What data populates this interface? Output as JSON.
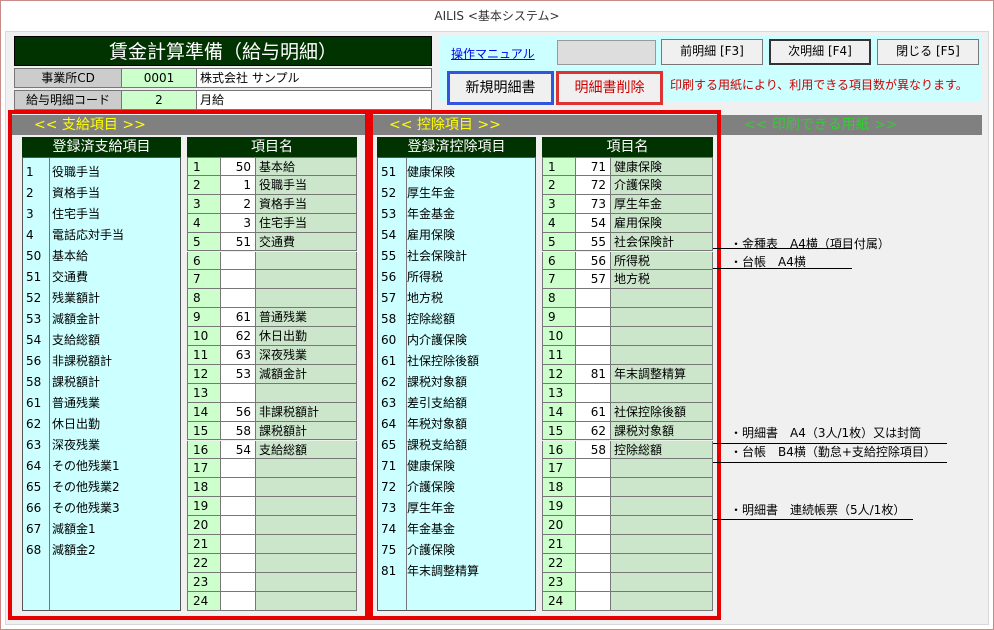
{
  "window": {
    "title": "AILIS <基本システム>"
  },
  "header": {
    "title": "賃金計算準備（給与明細）",
    "office_label": "事業所CD",
    "office_code": "0001",
    "company_name": "株式会社 サンプル",
    "payslip_label": "給与明細コード",
    "payslip_code": "2",
    "payslip_name": "月給"
  },
  "toolbar": {
    "manual_link": "操作マニュアル",
    "prev_button": "前明細 [F3]",
    "next_button": "次明細 [F4]",
    "close_button": "閉じる [F5]",
    "new_button": "新規明細書",
    "delete_button": "明細書削除",
    "notice": "印刷する用紙により、利用できる項目数が異なります。"
  },
  "sections": {
    "payment": "<< 支給項目 >>",
    "deduction": "<< 控除項目 >>",
    "paper": "<< 印刷できる用紙 >>"
  },
  "payment": {
    "registered_header": "登録済支給項目",
    "grid_header": "項目名",
    "registered": [
      {
        "code": "1",
        "name": "役職手当"
      },
      {
        "code": "2",
        "name": "資格手当"
      },
      {
        "code": "3",
        "name": "住宅手当"
      },
      {
        "code": "4",
        "name": "電話応対手当"
      },
      {
        "code": "50",
        "name": "基本給"
      },
      {
        "code": "51",
        "name": "交通費"
      },
      {
        "code": "52",
        "name": "残業額計"
      },
      {
        "code": "53",
        "name": "減額金計"
      },
      {
        "code": "54",
        "name": "支給総額"
      },
      {
        "code": "56",
        "name": "非課税額計"
      },
      {
        "code": "58",
        "name": "課税額計"
      },
      {
        "code": "61",
        "name": "普通残業"
      },
      {
        "code": "62",
        "name": "休日出勤"
      },
      {
        "code": "63",
        "name": "深夜残業"
      },
      {
        "code": "64",
        "name": "その他残業1"
      },
      {
        "code": "65",
        "name": "その他残業2"
      },
      {
        "code": "66",
        "name": "その他残業3"
      },
      {
        "code": "67",
        "name": "減額金1"
      },
      {
        "code": "68",
        "name": "減額金2"
      }
    ],
    "grid": [
      {
        "no": "1",
        "code": "50",
        "name": "基本給"
      },
      {
        "no": "2",
        "code": "1",
        "name": "役職手当"
      },
      {
        "no": "3",
        "code": "2",
        "name": "資格手当"
      },
      {
        "no": "4",
        "code": "3",
        "name": "住宅手当"
      },
      {
        "no": "5",
        "code": "51",
        "name": "交通費"
      },
      {
        "no": "6",
        "code": "",
        "name": ""
      },
      {
        "no": "7",
        "code": "",
        "name": ""
      },
      {
        "no": "8",
        "code": "",
        "name": ""
      },
      {
        "no": "9",
        "code": "61",
        "name": "普通残業"
      },
      {
        "no": "10",
        "code": "62",
        "name": "休日出勤"
      },
      {
        "no": "11",
        "code": "63",
        "name": "深夜残業"
      },
      {
        "no": "12",
        "code": "53",
        "name": "減額金計"
      },
      {
        "no": "13",
        "code": "",
        "name": ""
      },
      {
        "no": "14",
        "code": "56",
        "name": "非課税額計"
      },
      {
        "no": "15",
        "code": "58",
        "name": "課税額計"
      },
      {
        "no": "16",
        "code": "54",
        "name": "支給総額"
      },
      {
        "no": "17",
        "code": "",
        "name": ""
      },
      {
        "no": "18",
        "code": "",
        "name": ""
      },
      {
        "no": "19",
        "code": "",
        "name": ""
      },
      {
        "no": "20",
        "code": "",
        "name": ""
      },
      {
        "no": "21",
        "code": "",
        "name": ""
      },
      {
        "no": "22",
        "code": "",
        "name": ""
      },
      {
        "no": "23",
        "code": "",
        "name": ""
      },
      {
        "no": "24",
        "code": "",
        "name": ""
      }
    ]
  },
  "deduction": {
    "registered_header": "登録済控除項目",
    "grid_header": "項目名",
    "registered": [
      {
        "code": "51",
        "name": "健康保険"
      },
      {
        "code": "52",
        "name": "厚生年金"
      },
      {
        "code": "53",
        "name": "年金基金"
      },
      {
        "code": "54",
        "name": "雇用保険"
      },
      {
        "code": "55",
        "name": "社会保険計"
      },
      {
        "code": "56",
        "name": "所得税"
      },
      {
        "code": "57",
        "name": "地方税"
      },
      {
        "code": "58",
        "name": "控除総額"
      },
      {
        "code": "60",
        "name": "内介護保険"
      },
      {
        "code": "61",
        "name": "社保控除後額"
      },
      {
        "code": "62",
        "name": "課税対象額"
      },
      {
        "code": "63",
        "name": "差引支給額"
      },
      {
        "code": "64",
        "name": "年税対象額"
      },
      {
        "code": "65",
        "name": "課税支給額"
      },
      {
        "code": "71",
        "name": "健康保険"
      },
      {
        "code": "72",
        "name": "介護保険"
      },
      {
        "code": "73",
        "name": "厚生年金"
      },
      {
        "code": "74",
        "name": "年金基金"
      },
      {
        "code": "75",
        "name": "介護保険"
      },
      {
        "code": "81",
        "name": "年末調整精算"
      }
    ],
    "grid": [
      {
        "no": "1",
        "code": "71",
        "name": "健康保険"
      },
      {
        "no": "2",
        "code": "72",
        "name": "介護保険"
      },
      {
        "no": "3",
        "code": "73",
        "name": "厚生年金"
      },
      {
        "no": "4",
        "code": "54",
        "name": "雇用保険"
      },
      {
        "no": "5",
        "code": "55",
        "name": "社会保険計"
      },
      {
        "no": "6",
        "code": "56",
        "name": "所得税"
      },
      {
        "no": "7",
        "code": "57",
        "name": "地方税"
      },
      {
        "no": "8",
        "code": "",
        "name": ""
      },
      {
        "no": "9",
        "code": "",
        "name": ""
      },
      {
        "no": "10",
        "code": "",
        "name": ""
      },
      {
        "no": "11",
        "code": "",
        "name": ""
      },
      {
        "no": "12",
        "code": "81",
        "name": "年末調整精算"
      },
      {
        "no": "13",
        "code": "",
        "name": ""
      },
      {
        "no": "14",
        "code": "61",
        "name": "社保控除後額"
      },
      {
        "no": "15",
        "code": "62",
        "name": "課税対象額"
      },
      {
        "no": "16",
        "code": "58",
        "name": "控除総額"
      },
      {
        "no": "17",
        "code": "",
        "name": ""
      },
      {
        "no": "18",
        "code": "",
        "name": ""
      },
      {
        "no": "19",
        "code": "",
        "name": ""
      },
      {
        "no": "20",
        "code": "",
        "name": ""
      },
      {
        "no": "21",
        "code": "",
        "name": ""
      },
      {
        "no": "22",
        "code": "",
        "name": ""
      },
      {
        "no": "23",
        "code": "",
        "name": ""
      },
      {
        "no": "24",
        "code": "",
        "name": ""
      }
    ]
  },
  "papers": {
    "group1": [
      "・金種表　A4横（項目付属）",
      "・台帳　A4横"
    ],
    "group2": [
      "・明細書　A4（3人/1枚）又は封筒",
      "・台帳　B4横（勤怠+支給控除項目）"
    ],
    "group3": [
      "・明細書　連続帳票（5人/1枚）"
    ]
  },
  "colors": {
    "title_bg": "#003300",
    "highlight_red": "#e60000",
    "list_bg": "#ccffff",
    "section_yellow": "#ffff00",
    "section_green": "#33cc33"
  }
}
